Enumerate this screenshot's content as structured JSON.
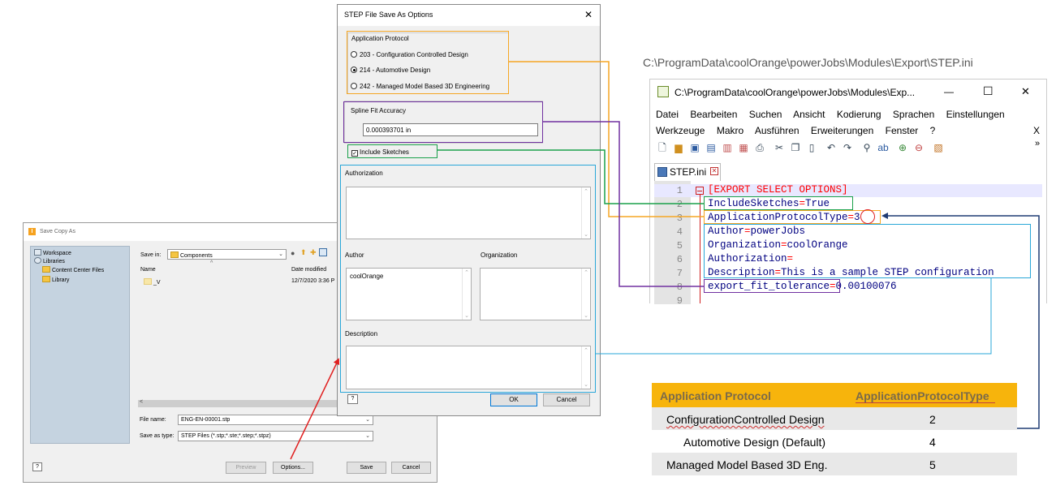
{
  "path_caption": "C:\\ProgramData\\coolOrange\\powerJobs\\Modules\\Export\\STEP.ini",
  "save_dialog": {
    "title": "Save Copy As",
    "app_icon": "I",
    "tree": {
      "workspace": "Workspace",
      "libraries": "Libraries",
      "content_center": "Content Center Files",
      "library": "Library"
    },
    "save_in_label": "Save in:",
    "save_in_value": "Components",
    "col_name": "Name",
    "col_date": "Date modified",
    "row_name": "_V",
    "row_date": "12/7/2020 3:36 P",
    "filename_label": "File name:",
    "filename_value": "ENG-EN-00001.stp",
    "saveas_label": "Save as type:",
    "saveas_value": "STEP Files (*.stp;*.ste;*.step;*.stpz)",
    "preview": "Preview",
    "options": "Options...",
    "save": "Save",
    "cancel": "Cancel"
  },
  "step_dialog": {
    "title": "STEP File Save As Options",
    "close": "✕",
    "app_protocol_label": "Application Protocol",
    "protocols": [
      {
        "label": "203 - Configuration Controlled Design",
        "selected": false
      },
      {
        "label": "214 - Automotive Design",
        "selected": true
      },
      {
        "label": "242 - Managed Model Based 3D Engineering",
        "selected": false
      }
    ],
    "spline_label": "Spline Fit Accuracy",
    "spline_value": "0.000393701 in",
    "include_sketches": "Include Sketches",
    "authorization_label": "Authorization",
    "author_label": "Author",
    "author_value": "coolOrange",
    "organization_label": "Organization",
    "description_label": "Description",
    "ok": "OK",
    "cancel": "Cancel"
  },
  "npp": {
    "title": "C:\\ProgramData\\coolOrange\\powerJobs\\Modules\\Exp...",
    "minimize": "—",
    "maximize": "☐",
    "close": "✕",
    "menu1": [
      "Datei",
      "Bearbeiten",
      "Suchen",
      "Ansicht",
      "Kodierung",
      "Sprachen",
      "Einstellungen"
    ],
    "menu2": [
      "Werkzeuge",
      "Makro",
      "Ausführen",
      "Erweiterungen",
      "Fenster",
      "?"
    ],
    "menu_close": "X",
    "more": "»",
    "tab": "STEP.ini",
    "line_numbers": [
      "1",
      "2",
      "3",
      "4",
      "5",
      "6",
      "7",
      "8",
      "9"
    ],
    "lines": {
      "l1": "[EXPORT SELECT OPTIONS]",
      "l2k": "IncludeSketches",
      "l2v": "True",
      "l3k": "ApplicationProtocolType",
      "l3v": "3",
      "l4k": "Author",
      "l4v": "powerJobs",
      "l5k": "Organization",
      "l5v": "coolOrange",
      "l6k": "Authorization",
      "l6v": "",
      "l7k": "Description",
      "l7v": "This is a sample STEP configuration",
      "l8k": "export_fit_tolerance",
      "l8v": "0.00100076",
      "eq": "="
    }
  },
  "table": {
    "headers": [
      "Application Protocol",
      "ApplicationProtocolType"
    ],
    "rows": [
      {
        "protocol": "ConfigurationControlled Design",
        "type": "2"
      },
      {
        "protocol": "Automotive Design (Default)",
        "type": "4"
      },
      {
        "protocol": "Managed Model Based 3D Eng.",
        "type": "5"
      }
    ]
  },
  "colors": {
    "orange": "#f5a623",
    "purple": "#7030a0",
    "green": "#1aa04a",
    "cyan": "#2aa7d8",
    "red": "#e02020",
    "navy": "#1f3b73",
    "table_header": "#f7b40c"
  }
}
